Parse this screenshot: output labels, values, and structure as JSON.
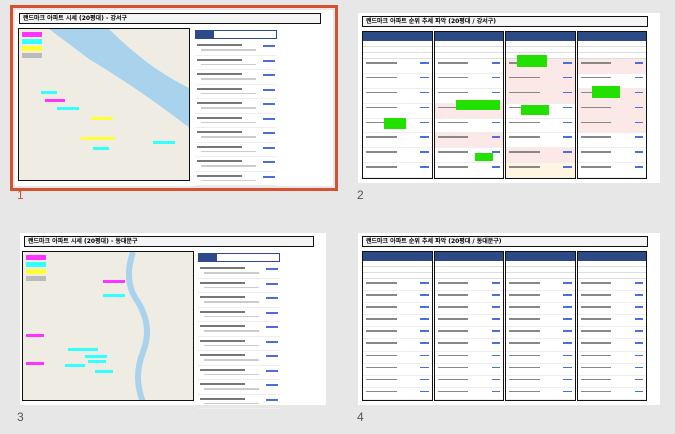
{
  "slides": [
    {
      "number": "1",
      "title": "랜드마크 아파트 시세 (20평대) - 강서구",
      "selected": true
    },
    {
      "number": "2",
      "title": "랜드마크 아파트 순위 추세 파악 (20평대 / 강서구)",
      "selected": false
    },
    {
      "number": "3",
      "title": "랜드마크 아파트 시세 (20평대) - 동대문구",
      "selected": false
    },
    {
      "number": "4",
      "title": "랜드마크 아파트 순위 추세 파악 (20평대 / 동대문구)",
      "selected": false
    }
  ],
  "colors": {
    "selection": "#d35230",
    "header": "#2b4a86"
  }
}
